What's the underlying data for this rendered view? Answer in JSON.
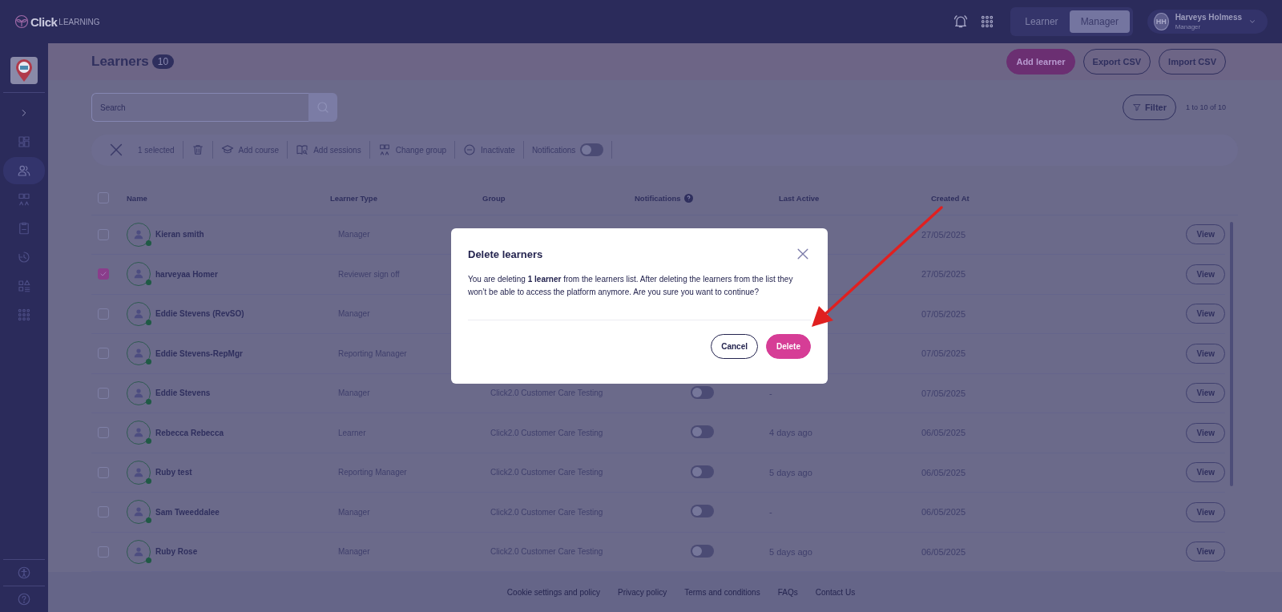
{
  "top_bar": {
    "logo": {
      "bold": "Click",
      "light": "LEARNING"
    },
    "role_tabs": [
      {
        "label": "Learner",
        "selected": false
      },
      {
        "label": "Manager",
        "selected": true
      }
    ],
    "user": {
      "initials": "HH",
      "name": "Harveys Holmess",
      "role": "Manager"
    }
  },
  "sidebar": {
    "items": [
      {
        "kind": "expand",
        "selected": false
      },
      {
        "kind": "dashboard",
        "selected": false
      },
      {
        "kind": "people",
        "selected": true
      },
      {
        "kind": "groups",
        "selected": false
      },
      {
        "kind": "clipboard",
        "selected": false
      },
      {
        "kind": "history",
        "selected": false
      },
      {
        "kind": "shapes",
        "selected": false
      },
      {
        "kind": "apps",
        "selected": false
      }
    ],
    "bottom_items": [
      {
        "kind": "accessibility"
      },
      {
        "kind": "help"
      }
    ]
  },
  "page": {
    "title": "Learners",
    "count": "10",
    "actions": [
      {
        "label": "Add learner",
        "kind": "primary"
      },
      {
        "label": "Export CSV",
        "kind": "outline"
      },
      {
        "label": "Import CSV",
        "kind": "outline"
      }
    ]
  },
  "search": {
    "placeholder": "Search"
  },
  "filter": {
    "label": "Filter"
  },
  "pagination": "1 to 10 of 10",
  "bulk_bar": {
    "selected_count": "1 selected",
    "actions": [
      {
        "kind": "delete"
      },
      {
        "kind": "course",
        "label": "Add course"
      },
      {
        "kind": "sessions",
        "label": "Add sessions"
      },
      {
        "kind": "group",
        "label": "Change group"
      },
      {
        "kind": "inactivate",
        "label": "Inactivate"
      }
    ],
    "notifications": {
      "label": "Notifications",
      "on": false
    }
  },
  "table": {
    "select_all": {
      "checked": false
    },
    "columns": [
      "Name",
      "Learner Type",
      "Group",
      "Notifications",
      "Last Active",
      "Created At"
    ],
    "rows": [
      {
        "name": "Kieran smith",
        "type": "Manager",
        "created": "27/05/2025",
        "action": "View",
        "checked": false
      },
      {
        "name": "harveyaa Homer",
        "type": "Reviewer sign off",
        "created": "27/05/2025",
        "action": "View",
        "checked": true
      },
      {
        "name": "Eddie Stevens (RevSO)",
        "type": "Manager",
        "created": "07/05/2025",
        "action": "View",
        "checked": false
      },
      {
        "name": "Eddie Stevens-RepMgr",
        "type": "Reporting Manager",
        "created": "07/05/2025",
        "action": "View",
        "checked": false
      },
      {
        "name": "Eddie Stevens",
        "type": "Manager",
        "group": "Click2.0 Customer Care Testing",
        "notifications_on": false,
        "last_active": "-",
        "created": "07/05/2025",
        "action": "View",
        "checked": false
      },
      {
        "name": "Rebecca Rebecca",
        "type": "Learner",
        "group": "Click2.0 Customer Care Testing",
        "notifications_on": false,
        "last_active": "4 days ago",
        "created": "06/05/2025",
        "action": "View",
        "checked": false
      },
      {
        "name": "Ruby test",
        "type": "Reporting Manager",
        "group": "Click2.0 Customer Care Testing",
        "notifications_on": false,
        "last_active": "5 days ago",
        "created": "06/05/2025",
        "action": "View",
        "checked": false
      },
      {
        "name": "Sam Tweeddalee",
        "type": "Manager",
        "group": "Click2.0 Customer Care Testing",
        "notifications_on": false,
        "last_active": "-",
        "created": "06/05/2025",
        "action": "View",
        "checked": false
      },
      {
        "name": "Ruby Rose",
        "type": "Manager",
        "group": "Click2.0 Customer Care Testing",
        "notifications_on": false,
        "last_active": "5 days ago",
        "created": "06/05/2025",
        "action": "View",
        "checked": false
      }
    ]
  },
  "dialog": {
    "title": "Delete learners",
    "message": "You are deleting **1 learner** from the learners list. After deleting the learners from the list they won’t be able to access the platform anymore. Are you sure you want to continue?",
    "buttons": [
      {
        "label": "Cancel",
        "kind": "secondary"
      },
      {
        "label": "Delete",
        "kind": "danger"
      }
    ]
  },
  "footer": {
    "links": [
      "Cookie settings and policy",
      "Privacy policy",
      "Terms and conditions",
      "FAQs",
      "Contact Us"
    ]
  }
}
